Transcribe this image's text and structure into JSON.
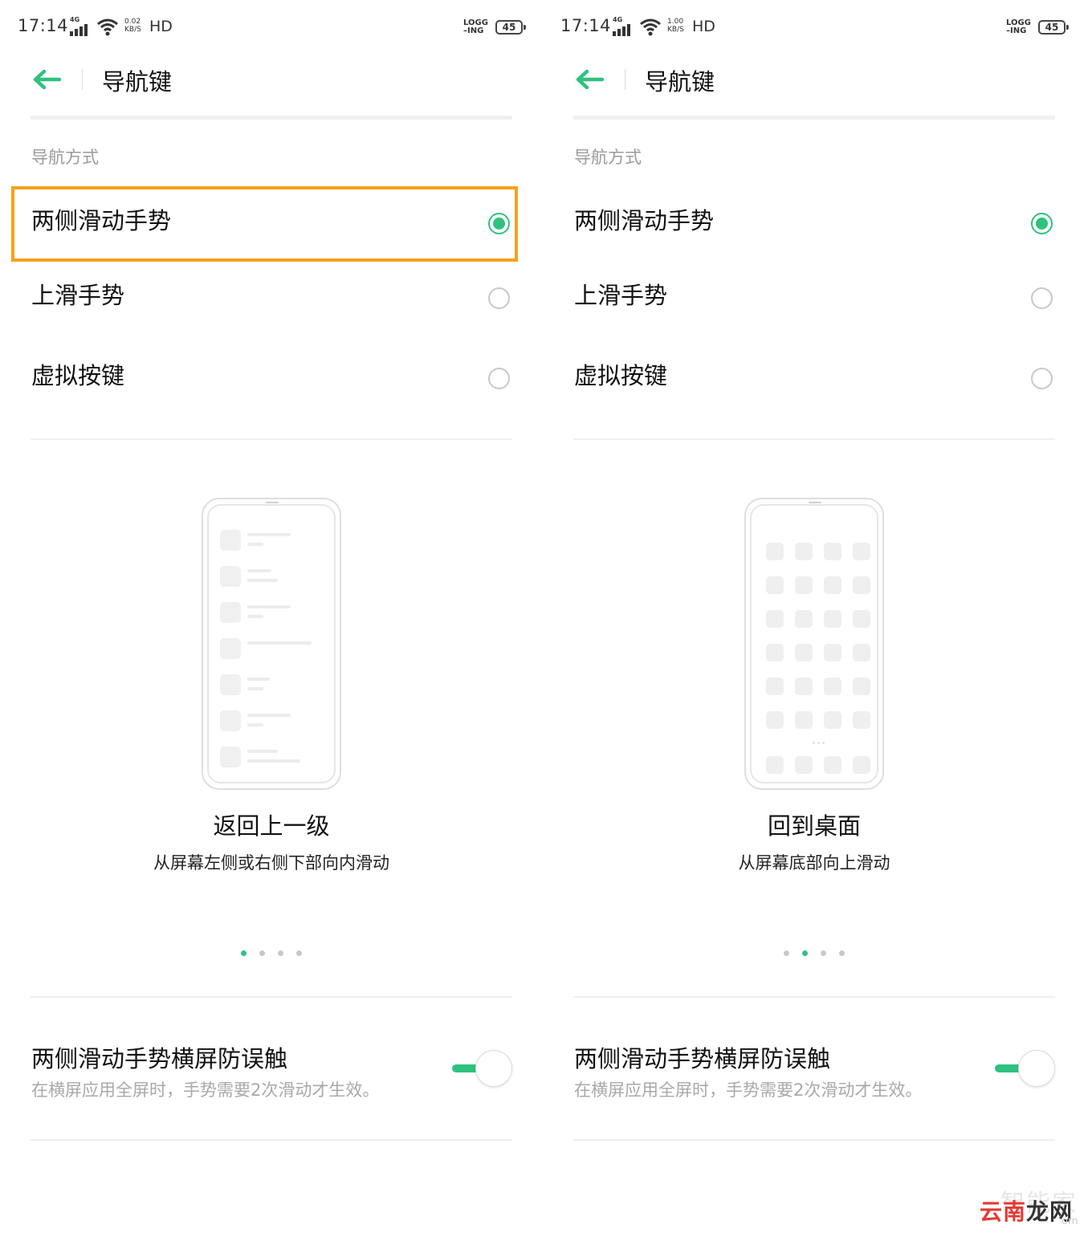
{
  "colors": {
    "accent": "#2ec27e",
    "highlight": "#f7a01d"
  },
  "panels": [
    {
      "status": {
        "time": "17:14",
        "network": "4G",
        "speed_value": "0.02",
        "speed_unit": "KB/S",
        "hd": "HD",
        "logging_top": "LOGG",
        "logging_bottom": "ING",
        "battery": "45"
      },
      "header": {
        "title": "导航键",
        "back_icon": "arrow-left-icon"
      },
      "section_label": "导航方式",
      "options": [
        {
          "label": "两侧滑动手势",
          "selected": true
        },
        {
          "label": "上滑手势",
          "selected": false
        },
        {
          "label": "虚拟按键",
          "selected": false
        }
      ],
      "illustration": "app-list",
      "gesture_title": "返回上一级",
      "gesture_desc": "从屏幕左侧或右侧下部向内滑动",
      "pager_active_index": 0,
      "toggle": {
        "title": "两侧滑动手势横屏防误触",
        "desc": "在横屏应用全屏时，手势需要2次滑动才生效。",
        "on": true
      }
    },
    {
      "status": {
        "time": "17:14",
        "network": "4G",
        "speed_value": "1.00",
        "speed_unit": "KB/S",
        "hd": "HD",
        "logging_top": "LOGG",
        "logging_bottom": "ING",
        "battery": "45"
      },
      "header": {
        "title": "导航键",
        "back_icon": "arrow-left-icon"
      },
      "section_label": "导航方式",
      "options": [
        {
          "label": "两侧滑动手势",
          "selected": true
        },
        {
          "label": "上滑手势",
          "selected": false
        },
        {
          "label": "虚拟按键",
          "selected": false
        }
      ],
      "illustration": "home-grid",
      "gesture_title": "回到桌面",
      "gesture_desc": "从屏幕底部向上滑动",
      "pager_active_index": 1,
      "toggle": {
        "title": "两侧滑动手势横屏防误触",
        "desc": "在横屏应用全屏时，手势需要2次滑动才生效。",
        "on": true
      }
    }
  ],
  "watermark": {
    "top": "智能家",
    "main_red": "云南",
    "main_dark": "龙网",
    "small": "om"
  }
}
